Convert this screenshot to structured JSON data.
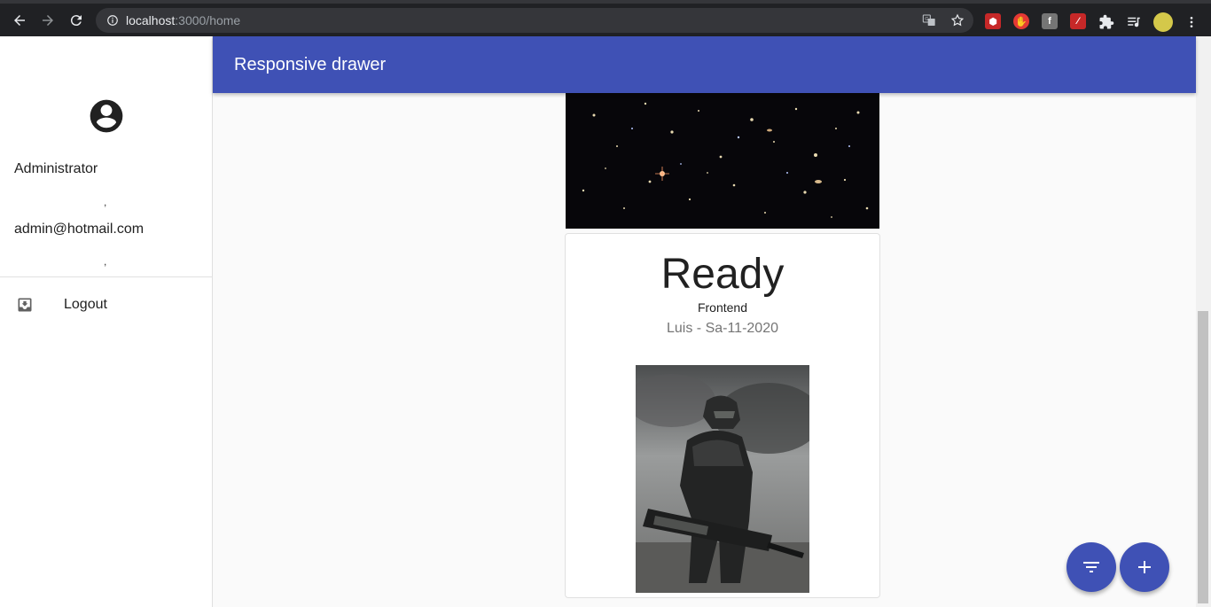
{
  "browser": {
    "url_host": "localhost",
    "url_rest": ":3000/home"
  },
  "appbar": {
    "title": "Responsive drawer"
  },
  "drawer": {
    "user_name": "Administrator",
    "separator_1": ",",
    "user_email": "admin@hotmail.com",
    "separator_2": ",",
    "logout_label": "Logout"
  },
  "card": {
    "title": "Ready",
    "category": "Frontend",
    "meta": "Luis - Sa-11-2020"
  },
  "colors": {
    "primary": "#3f51b5",
    "chrome_dark": "#202124"
  },
  "icons": {
    "back": "arrow-left-icon",
    "forward": "arrow-right-icon",
    "reload": "reload-icon",
    "info": "info-icon",
    "translate": "translate-icon",
    "bookmark": "star-icon",
    "avatar": "account-circle-icon",
    "logout": "move-to-inbox-icon",
    "filter": "filter-list-icon",
    "add": "plus-icon"
  }
}
